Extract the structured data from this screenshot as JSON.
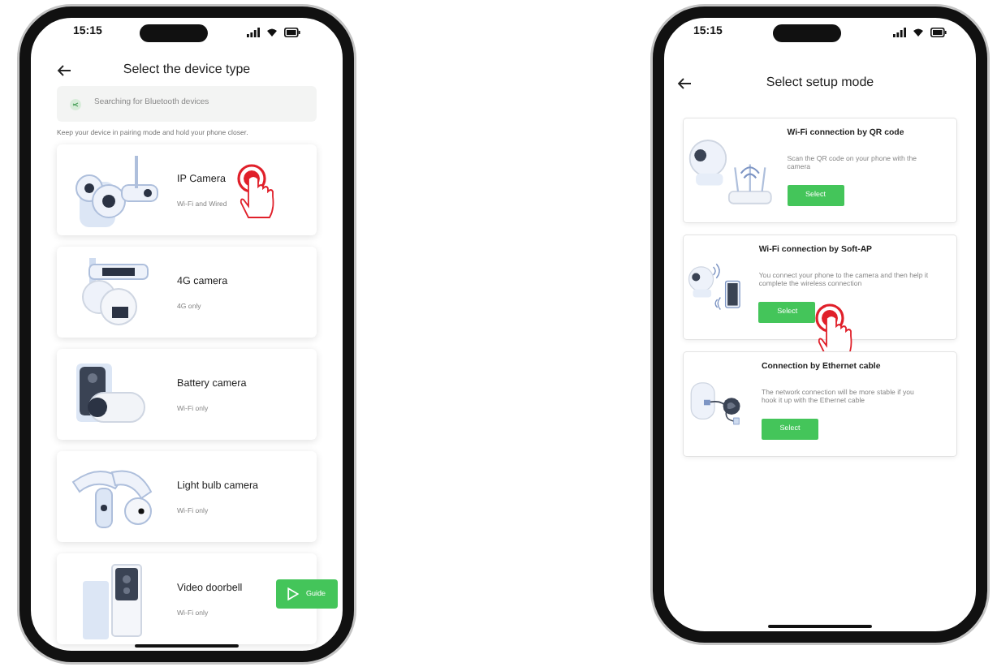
{
  "device_type_screen": {
    "status_time": "15:15",
    "title": "Select the device type",
    "search_placeholder": "Searching for Bluetooth devices",
    "hint": "Keep your device in pairing mode and hold your phone closer.",
    "devices": [
      {
        "name": "IP Camera",
        "subtitle": "Wi-Fi and Wired",
        "tapped": true
      },
      {
        "name": "4G camera",
        "subtitle": "4G only",
        "tapped": false
      },
      {
        "name": "Battery camera",
        "subtitle": "Wi-Fi only",
        "tapped": false
      },
      {
        "name": "Light bulb camera",
        "subtitle": "Wi-Fi only",
        "tapped": false
      },
      {
        "name": "Video doorbell",
        "subtitle": "Wi-Fi only",
        "tapped": false
      }
    ],
    "guide_button": "Guide"
  },
  "setup_mode_screen": {
    "status_time": "15:15",
    "title": "Select setup mode",
    "modes": [
      {
        "title": "Wi-Fi connection by QR code",
        "description": "Scan the QR code on your phone with the camera",
        "button": "Select",
        "tapped": false
      },
      {
        "title": "Wi-Fi connection by Soft-AP",
        "description": "You connect your phone to the camera and then help it complete the wireless connection",
        "button": "Select",
        "tapped": true
      },
      {
        "title": "Connection by Ethernet cable",
        "description": "The network connection will be more stable if you hook it up with the Ethernet cable",
        "button": "Select",
        "tapped": false
      }
    ]
  }
}
